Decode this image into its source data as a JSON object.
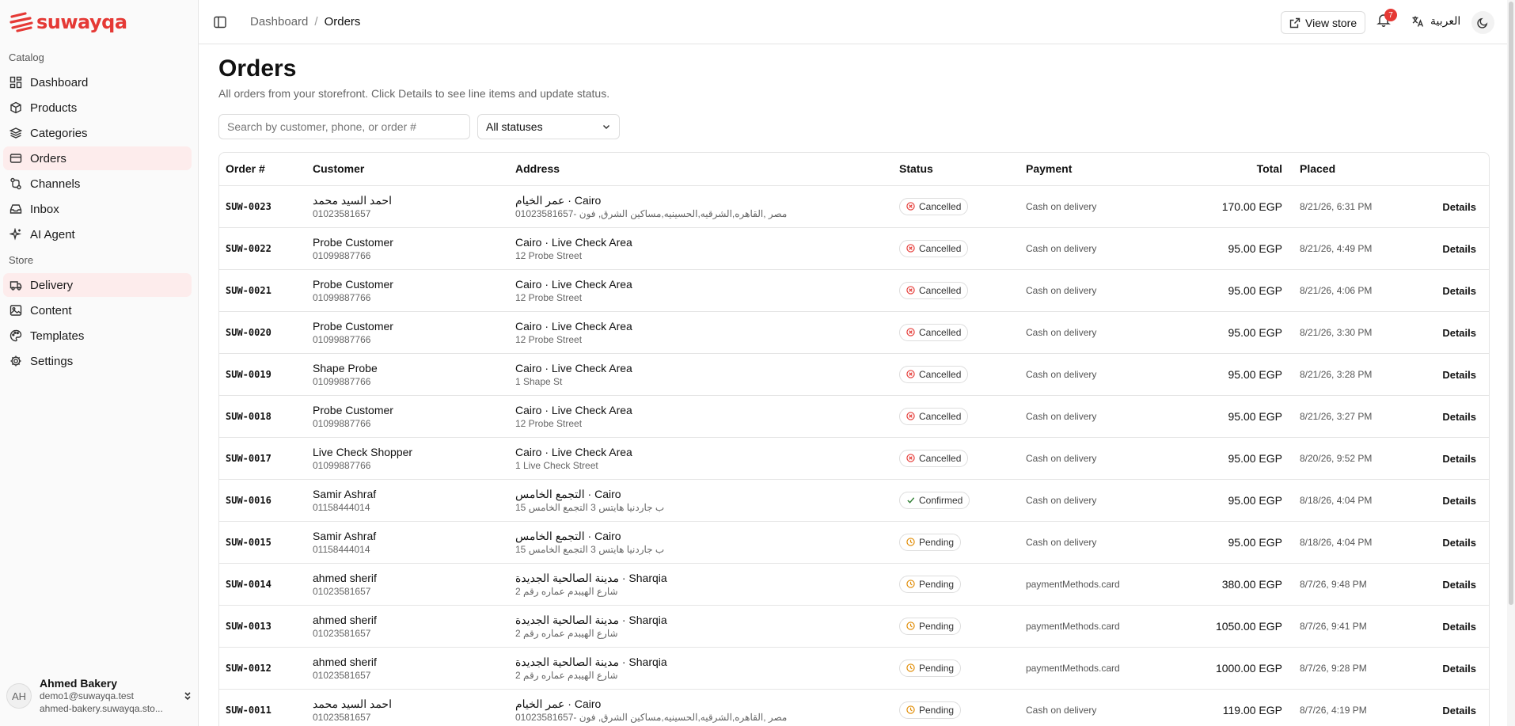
{
  "brand": {
    "name": "suwayqa",
    "color": "#e53935"
  },
  "sidebar": {
    "sections": [
      {
        "title": "Catalog",
        "items": [
          {
            "label": "Dashboard",
            "icon": "dashboard-icon"
          },
          {
            "label": "Products",
            "icon": "box-icon"
          },
          {
            "label": "Categories",
            "icon": "layers-icon"
          },
          {
            "label": "Orders",
            "icon": "orders-icon",
            "active": true
          },
          {
            "label": "Channels",
            "icon": "channels-icon"
          },
          {
            "label": "Inbox",
            "icon": "inbox-icon"
          },
          {
            "label": "AI Agent",
            "icon": "sparkles-icon"
          }
        ]
      },
      {
        "title": "Store",
        "items": [
          {
            "label": "Delivery",
            "icon": "truck-icon",
            "active": true
          },
          {
            "label": "Content",
            "icon": "image-icon"
          },
          {
            "label": "Templates",
            "icon": "palette-icon"
          },
          {
            "label": "Settings",
            "icon": "gear-icon"
          }
        ]
      }
    ],
    "user": {
      "initials": "AH",
      "name": "Ahmed Bakery",
      "email": "demo1@suwayqa.test",
      "domain": "ahmed-bakery.suwayqa.sto..."
    }
  },
  "topbar": {
    "breadcrumb": {
      "parent": "Dashboard",
      "separator": "/",
      "current": "Orders"
    },
    "view_store": "View store",
    "notifications": "7",
    "language": "العربية"
  },
  "page": {
    "title": "Orders",
    "description": "All orders from your storefront. Click Details to see line items and update status.",
    "search_placeholder": "Search by customer, phone, or order #",
    "status_filter": "All statuses"
  },
  "table": {
    "columns": {
      "order": "Order #",
      "customer": "Customer",
      "address": "Address",
      "status": "Status",
      "payment": "Payment",
      "total": "Total",
      "placed": "Placed"
    },
    "details_label": "Details",
    "rows": [
      {
        "order": "SUW-0023",
        "name": "احمد السيد محمد",
        "phone": "01023581657",
        "addr": "عمر الخيام · Cairo",
        "addr_sub": "مصر ,القاهره,الشرقيه,الحسينيه,مساكين الشرق, فون -01023581657",
        "status": "Cancelled",
        "payment": "Cash on delivery",
        "total": "170.00 EGP",
        "placed": "8/21/26, 6:31 PM"
      },
      {
        "order": "SUW-0022",
        "name": "Probe Customer",
        "phone": "01099887766",
        "addr": "Cairo · Live Check Area",
        "addr_sub": "12 Probe Street",
        "status": "Cancelled",
        "payment": "Cash on delivery",
        "total": "95.00 EGP",
        "placed": "8/21/26, 4:49 PM"
      },
      {
        "order": "SUW-0021",
        "name": "Probe Customer",
        "phone": "01099887766",
        "addr": "Cairo · Live Check Area",
        "addr_sub": "12 Probe Street",
        "status": "Cancelled",
        "payment": "Cash on delivery",
        "total": "95.00 EGP",
        "placed": "8/21/26, 4:06 PM"
      },
      {
        "order": "SUW-0020",
        "name": "Probe Customer",
        "phone": "01099887766",
        "addr": "Cairo · Live Check Area",
        "addr_sub": "12 Probe Street",
        "status": "Cancelled",
        "payment": "Cash on delivery",
        "total": "95.00 EGP",
        "placed": "8/21/26, 3:30 PM"
      },
      {
        "order": "SUW-0019",
        "name": "Shape Probe",
        "phone": "01099887766",
        "addr": "Cairo · Live Check Area",
        "addr_sub": "1 Shape St",
        "status": "Cancelled",
        "payment": "Cash on delivery",
        "total": "95.00 EGP",
        "placed": "8/21/26, 3:28 PM"
      },
      {
        "order": "SUW-0018",
        "name": "Probe Customer",
        "phone": "01099887766",
        "addr": "Cairo · Live Check Area",
        "addr_sub": "12 Probe Street",
        "status": "Cancelled",
        "payment": "Cash on delivery",
        "total": "95.00 EGP",
        "placed": "8/21/26, 3:27 PM"
      },
      {
        "order": "SUW-0017",
        "name": "Live Check Shopper",
        "phone": "01099887766",
        "addr": "Cairo · Live Check Area",
        "addr_sub": "1 Live Check Street",
        "status": "Cancelled",
        "payment": "Cash on delivery",
        "total": "95.00 EGP",
        "placed": "8/20/26, 9:52 PM"
      },
      {
        "order": "SUW-0016",
        "name": "Samir Ashraf",
        "phone": "01158444014",
        "addr": "التجمع الخامس · Cairo",
        "addr_sub": "ب جاردنيا هايتس 3 التجمع الخامس 15",
        "status": "Confirmed",
        "payment": "Cash on delivery",
        "total": "95.00 EGP",
        "placed": "8/18/26, 4:04 PM"
      },
      {
        "order": "SUW-0015",
        "name": "Samir Ashraf",
        "phone": "01158444014",
        "addr": "التجمع الخامس · Cairo",
        "addr_sub": "ب جاردنيا هايتس 3 التجمع الخامس 15",
        "status": "Pending",
        "payment": "Cash on delivery",
        "total": "95.00 EGP",
        "placed": "8/18/26, 4:04 PM"
      },
      {
        "order": "SUW-0014",
        "name": "ahmed sherif",
        "phone": "01023581657",
        "addr": "مدينة الصالحية الجديدة · Sharqia",
        "addr_sub": "شارع الهيبدم عماره رقم 2",
        "status": "Pending",
        "payment": "paymentMethods.card",
        "total": "380.00 EGP",
        "placed": "8/7/26, 9:48 PM"
      },
      {
        "order": "SUW-0013",
        "name": "ahmed sherif",
        "phone": "01023581657",
        "addr": "مدينة الصالحية الجديدة · Sharqia",
        "addr_sub": "شارع الهيبدم عماره رقم 2",
        "status": "Pending",
        "payment": "paymentMethods.card",
        "total": "1050.00 EGP",
        "placed": "8/7/26, 9:41 PM"
      },
      {
        "order": "SUW-0012",
        "name": "ahmed sherif",
        "phone": "01023581657",
        "addr": "مدينة الصالحية الجديدة · Sharqia",
        "addr_sub": "شارع الهيبدم عماره رقم 2",
        "status": "Pending",
        "payment": "paymentMethods.card",
        "total": "1000.00 EGP",
        "placed": "8/7/26, 9:28 PM"
      },
      {
        "order": "SUW-0011",
        "name": "احمد السيد محمد",
        "phone": "01023581657",
        "addr": "عمر الخيام · Cairo",
        "addr_sub": "مصر ,القاهره,الشرقيه,الحسينيه,مساكين الشرق, فون -01023581657",
        "status": "Pending",
        "payment": "Cash on delivery",
        "total": "119.00 EGP",
        "placed": "8/7/26, 4:19 PM"
      }
    ]
  },
  "colors": {
    "cancelled": "#e53935",
    "confirmed": "#2e7d32",
    "pending": "#e08a00",
    "active_nav": "#fdecec"
  }
}
